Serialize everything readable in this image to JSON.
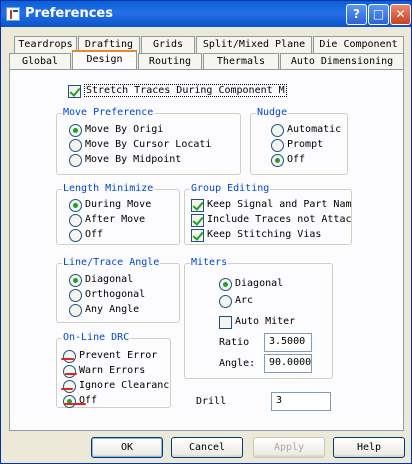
{
  "window": {
    "title": "Preferences"
  },
  "tabs_row1": [
    "Teardrops",
    "Drafting",
    "Grids",
    "Split/Mixed Plane",
    "Die Component"
  ],
  "tabs_row2": [
    "Global",
    "Design",
    "Routing",
    "Thermals",
    "Auto Dimensioning"
  ],
  "active_tab": "Design",
  "stretch": {
    "label": "Stretch Traces During Component M",
    "checked": true
  },
  "move_pref": {
    "title": "Move Preference",
    "options": [
      "Move By Origi",
      "Move By Cursor Locati",
      "Move By Midpoint"
    ],
    "selected": 0
  },
  "nudge": {
    "title": "Nudge",
    "options": [
      "Automatic",
      "Prompt",
      "Off"
    ],
    "selected": 2
  },
  "length_min": {
    "title": "Length Minimize",
    "options": [
      "During Move",
      "After Move",
      "Off"
    ],
    "selected": 0
  },
  "group_edit": {
    "title": "Group Editing",
    "options": [
      "Keep Signal and Part Nam",
      "Include Traces not Attac",
      "Keep Stitching Vias"
    ],
    "checked": [
      true,
      true,
      true
    ]
  },
  "line_trace": {
    "title": "Line/Trace Angle",
    "options": [
      "Diagonal",
      "Orthogonal",
      "Any Angle"
    ],
    "selected": 0
  },
  "miters": {
    "title": "Miters",
    "options": [
      "Diagonal",
      "Arc"
    ],
    "selected": 0,
    "auto_miter_label": "Auto Miter",
    "auto_miter_checked": false,
    "ratio_label": "Ratio",
    "ratio_value": "3.5000",
    "angle_label": "Angle:",
    "angle_value": "90.0000"
  },
  "online_drc": {
    "title": "On-Line DRC",
    "options": [
      "Prevent Error",
      "Warn Errors",
      "Ignore Clearanc",
      "Off"
    ],
    "selected": 3
  },
  "drill": {
    "label": "Drill",
    "value": "3"
  },
  "buttons": {
    "ok": "OK",
    "cancel": "Cancel",
    "apply": "Apply",
    "help": "Help"
  },
  "colors": {
    "title_bar": "#0a5fd8",
    "group_title": "#0046d5",
    "annotation": "#e1241f"
  }
}
